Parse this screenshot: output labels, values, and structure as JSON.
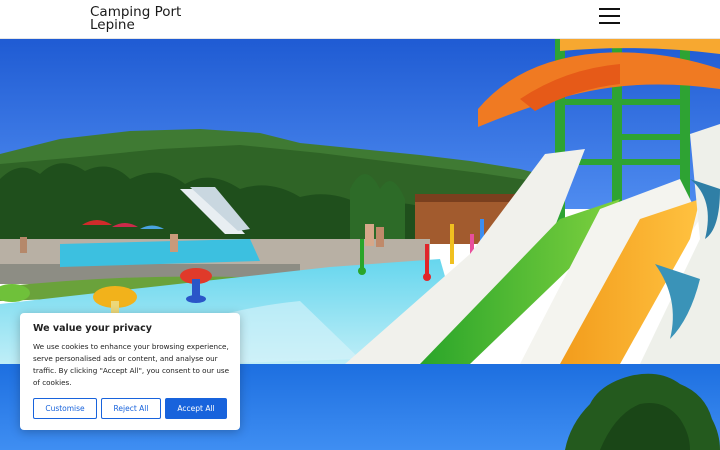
{
  "header": {
    "title_line1": "Camping Port",
    "title_line2": "Lepine",
    "menu_icon": "hamburger-menu-icon"
  },
  "hero": {
    "image_description_icon": "waterpark-photo"
  },
  "cookie_banner": {
    "title": "We value your privacy",
    "text": "We use cookies to enhance your browsing experience, serve personalised ads or content, and analyse our traffic. By clicking \"Accept All\", you consent to our use of cookies.",
    "customise_label": "Customise",
    "reject_label": "Reject All",
    "accept_label": "Accept All",
    "accent_color": "#1863dc"
  }
}
